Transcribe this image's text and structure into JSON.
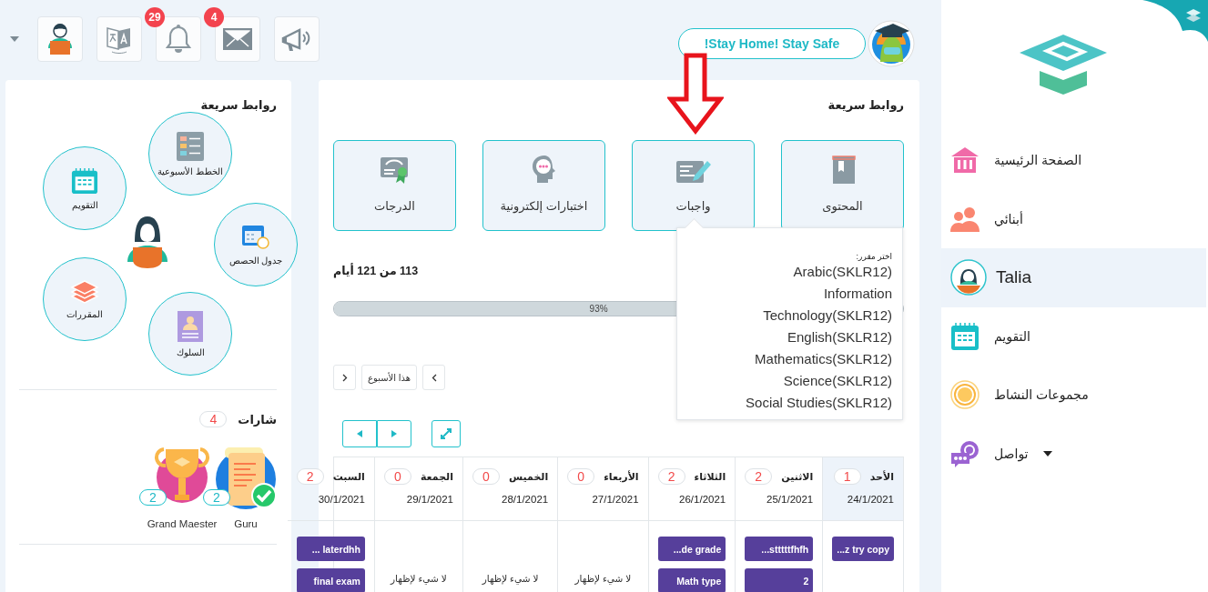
{
  "topbar": {
    "notifications_count": "29",
    "messages_count": "4",
    "announcement": "!Stay Home! Stay Safe"
  },
  "sidebar": {
    "items": [
      {
        "kind": "home",
        "label": "الصفحة الرئيسية",
        "selected": false,
        "expandable": false
      },
      {
        "kind": "children",
        "label": "أبنائي",
        "selected": false,
        "expandable": false
      },
      {
        "kind": "child",
        "label": "Talia",
        "selected": true,
        "expandable": false
      },
      {
        "kind": "calendar",
        "label": "التقويم",
        "selected": false,
        "expandable": false
      },
      {
        "kind": "groups",
        "label": "مجموعات النشاط",
        "selected": false,
        "expandable": false
      },
      {
        "kind": "messages",
        "label": "تواصل",
        "selected": false,
        "expandable": true
      }
    ]
  },
  "quick_links": {
    "title": "روابط سريعة",
    "links": [
      {
        "kind": "plans",
        "label": "الخطط الأسبوعية"
      },
      {
        "kind": "calendar",
        "label": "التقويم"
      },
      {
        "kind": "schedule",
        "label": "جدول الحصص"
      },
      {
        "kind": "courses",
        "label": "المقررات"
      },
      {
        "kind": "behavior",
        "label": "السلوك"
      }
    ]
  },
  "badges": {
    "title": "شارات",
    "count": "4",
    "items": [
      {
        "kind": "scroll",
        "name": "Guru",
        "count": "2"
      },
      {
        "kind": "trophy",
        "name": "Grand Maester",
        "count": "2"
      }
    ]
  },
  "main": {
    "title": "روابط سريعة",
    "tiles": [
      {
        "kind": "content",
        "label": "المحتوى"
      },
      {
        "kind": "homework",
        "label": "واجبات"
      },
      {
        "kind": "quiz",
        "label": "اختبارات إلكترونية"
      },
      {
        "kind": "grades",
        "label": "الدرجات"
      }
    ],
    "progress": {
      "text": "113 من 121 أيام",
      "level": 0.93,
      "reading": "93%"
    },
    "week_nav": {
      "label": "هذا الأسبوع"
    },
    "calendar": {
      "days": [
        {
          "name": "الأحد",
          "count": "1",
          "date": "24/1/2021",
          "selected": true,
          "tasks": [
            "...z try copy"
          ]
        },
        {
          "name": "الاثنين",
          "count": "2",
          "date": "25/1/2021",
          "selected": false,
          "tasks": [
            "...stttttfhfh",
            "2"
          ]
        },
        {
          "name": "الثلاثاء",
          "count": "2",
          "date": "26/1/2021",
          "selected": false,
          "tasks": [
            "...de grade",
            "Math type"
          ]
        },
        {
          "name": "الأربعاء",
          "count": "0",
          "date": "27/1/2021",
          "selected": false,
          "empty_text": "لا شيء لإظهار"
        },
        {
          "name": "الخميس",
          "count": "0",
          "date": "28/1/2021",
          "selected": false,
          "empty_text": "لا شيء لإظهار"
        },
        {
          "name": "الجمعة",
          "count": "0",
          "date": "29/1/2021",
          "selected": false,
          "empty_text": "لا شيء لإظهار"
        },
        {
          "name": "السبت",
          "count": "2",
          "date": "30/1/2021",
          "selected": false,
          "tasks": [
            "... laterdhh",
            "final exam"
          ]
        }
      ]
    }
  },
  "course_popup": {
    "heading": "اختر مقرر:",
    "courses": [
      "Arabic(SKLR12)",
      "Information",
      "Technology(SKLR12)",
      "English(SKLR12)",
      "Mathematics(SKLR12)",
      "Science(SKLR12)",
      "Social Studies(SKLR12)"
    ]
  }
}
